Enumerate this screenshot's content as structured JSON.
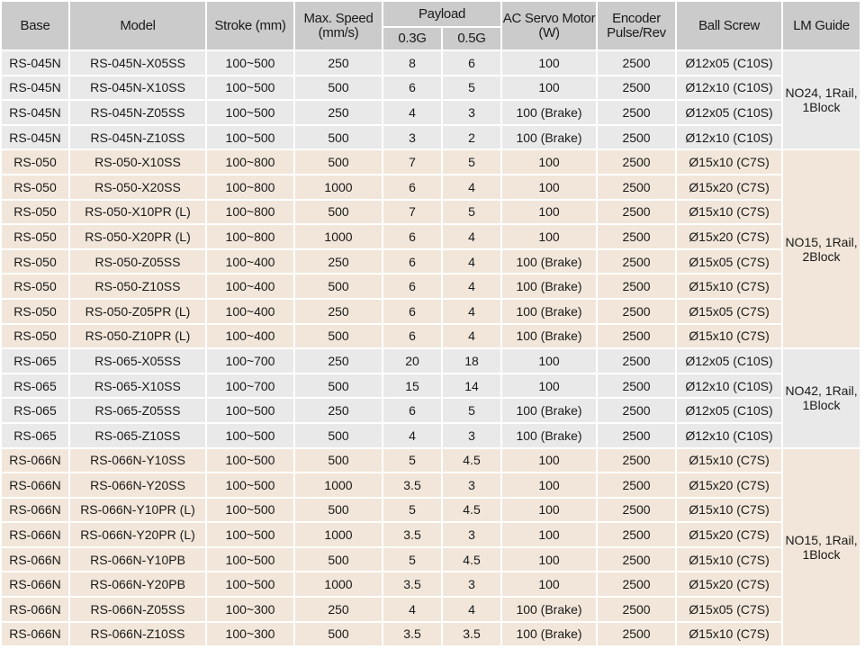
{
  "table": {
    "headers": {
      "base": "Base",
      "model": "Model",
      "stroke": "Stroke (mm)",
      "max_speed": "Max. Speed (mm/s)",
      "payload": "Payload",
      "payload_03g": "0.3G",
      "payload_05g": "0.5G",
      "motor": "AC Servo Motor (W)",
      "encoder": "Encoder Pulse/Rev",
      "ball_screw": "Ball Screw",
      "lm_guide": "LM Guide"
    },
    "colors": {
      "header_bg": "#cbcbcb",
      "group_grey": "#e9e9e9",
      "group_tan": "#f1e6d9"
    },
    "groups": [
      {
        "lm_guide": "NO24, 1Rail, 1Block",
        "tone": "grey",
        "rows": [
          [
            "RS-045N",
            "RS-045N-X05SS",
            "100~500",
            "250",
            "8",
            "6",
            "100",
            "2500",
            "Ø12x05 (C10S)"
          ],
          [
            "RS-045N",
            "RS-045N-X10SS",
            "100~500",
            "500",
            "6",
            "5",
            "100",
            "2500",
            "Ø12x10 (C10S)"
          ],
          [
            "RS-045N",
            "RS-045N-Z05SS",
            "100~500",
            "250",
            "4",
            "3",
            "100 (Brake)",
            "2500",
            "Ø12x05 (C10S)"
          ],
          [
            "RS-045N",
            "RS-045N-Z10SS",
            "100~500",
            "500",
            "3",
            "2",
            "100 (Brake)",
            "2500",
            "Ø12x10 (C10S)"
          ]
        ]
      },
      {
        "lm_guide": "NO15, 1Rail, 2Block",
        "tone": "tan",
        "rows": [
          [
            "RS-050",
            "RS-050-X10SS",
            "100~800",
            "500",
            "7",
            "5",
            "100",
            "2500",
            "Ø15x10 (C7S)"
          ],
          [
            "RS-050",
            "RS-050-X20SS",
            "100~800",
            "1000",
            "6",
            "4",
            "100",
            "2500",
            "Ø15x20 (C7S)"
          ],
          [
            "RS-050",
            "RS-050-X10PR (L)",
            "100~800",
            "500",
            "7",
            "5",
            "100",
            "2500",
            "Ø15x10 (C7S)"
          ],
          [
            "RS-050",
            "RS-050-X20PR (L)",
            "100~800",
            "1000",
            "6",
            "4",
            "100",
            "2500",
            "Ø15x20 (C7S)"
          ],
          [
            "RS-050",
            "RS-050-Z05SS",
            "100~400",
            "250",
            "6",
            "4",
            "100 (Brake)",
            "2500",
            "Ø15x05 (C7S)"
          ],
          [
            "RS-050",
            "RS-050-Z10SS",
            "100~400",
            "500",
            "6",
            "4",
            "100 (Brake)",
            "2500",
            "Ø15x10 (C7S)"
          ],
          [
            "RS-050",
            "RS-050-Z05PR (L)",
            "100~400",
            "250",
            "6",
            "4",
            "100 (Brake)",
            "2500",
            "Ø15x05 (C7S)"
          ],
          [
            "RS-050",
            "RS-050-Z10PR (L)",
            "100~400",
            "500",
            "6",
            "4",
            "100 (Brake)",
            "2500",
            "Ø15x10 (C7S)"
          ]
        ]
      },
      {
        "lm_guide": "NO42, 1Rail, 1Block",
        "tone": "grey",
        "rows": [
          [
            "RS-065",
            "RS-065-X05SS",
            "100~700",
            "250",
            "20",
            "18",
            "100",
            "2500",
            "Ø12x05 (C10S)"
          ],
          [
            "RS-065",
            "RS-065-X10SS",
            "100~700",
            "500",
            "15",
            "14",
            "100",
            "2500",
            "Ø12x10 (C10S)"
          ],
          [
            "RS-065",
            "RS-065-Z05SS",
            "100~500",
            "250",
            "6",
            "5",
            "100 (Brake)",
            "2500",
            "Ø12x05 (C10S)"
          ],
          [
            "RS-065",
            "RS-065-Z10SS",
            "100~500",
            "500",
            "4",
            "3",
            "100 (Brake)",
            "2500",
            "Ø12x10 (C10S)"
          ]
        ]
      },
      {
        "lm_guide": "NO15, 1Rail, 1Block",
        "tone": "tan",
        "rows": [
          [
            "RS-066N",
            "RS-066N-Y10SS",
            "100~500",
            "500",
            "5",
            "4.5",
            "100",
            "2500",
            "Ø15x10 (C7S)"
          ],
          [
            "RS-066N",
            "RS-066N-Y20SS",
            "100~500",
            "1000",
            "3.5",
            "3",
            "100",
            "2500",
            "Ø15x20 (C7S)"
          ],
          [
            "RS-066N",
            "RS-066N-Y10PR (L)",
            "100~500",
            "500",
            "5",
            "4.5",
            "100",
            "2500",
            "Ø15x10 (C7S)"
          ],
          [
            "RS-066N",
            "RS-066N-Y20PR (L)",
            "100~500",
            "1000",
            "3.5",
            "3",
            "100",
            "2500",
            "Ø15x20 (C7S)"
          ],
          [
            "RS-066N",
            "RS-066N-Y10PB",
            "100~500",
            "500",
            "5",
            "4.5",
            "100",
            "2500",
            "Ø15x10 (C7S)"
          ],
          [
            "RS-066N",
            "RS-066N-Y20PB",
            "100~500",
            "1000",
            "3.5",
            "3",
            "100",
            "2500",
            "Ø15x20 (C7S)"
          ],
          [
            "RS-066N",
            "RS-066N-Z05SS",
            "100~300",
            "250",
            "4",
            "4",
            "100 (Brake)",
            "2500",
            "Ø15x05 (C7S)"
          ],
          [
            "RS-066N",
            "RS-066N-Z10SS",
            "100~300",
            "500",
            "3.5",
            "3.5",
            "100 (Brake)",
            "2500",
            "Ø15x10 (C7S)"
          ]
        ]
      }
    ]
  }
}
